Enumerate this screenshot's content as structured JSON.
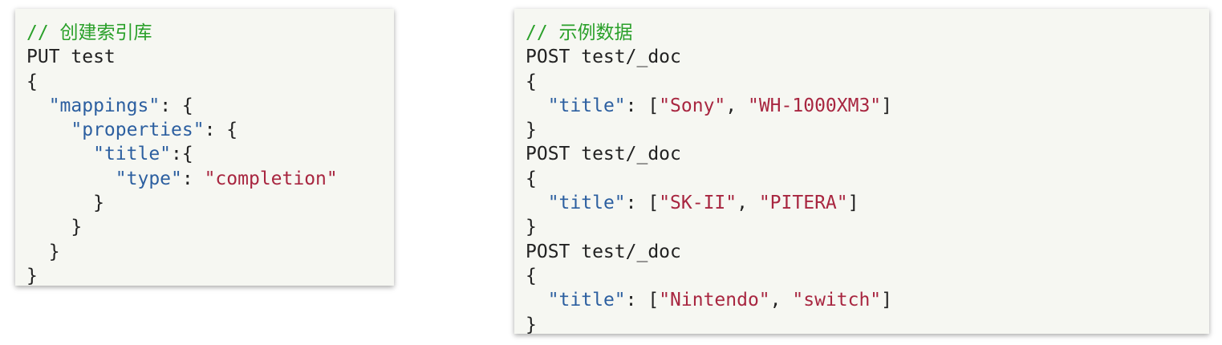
{
  "blocks": [
    {
      "lines": [
        [
          {
            "c": "comment",
            "t": "// 创建索引库"
          }
        ],
        [
          {
            "c": "plain",
            "t": "PUT test"
          }
        ],
        [
          {
            "c": "plain",
            "t": "{"
          }
        ],
        [
          {
            "c": "plain",
            "t": "  "
          },
          {
            "c": "key",
            "t": "\"mappings\""
          },
          {
            "c": "plain",
            "t": ": {"
          }
        ],
        [
          {
            "c": "plain",
            "t": "    "
          },
          {
            "c": "key",
            "t": "\"properties\""
          },
          {
            "c": "plain",
            "t": ": {"
          }
        ],
        [
          {
            "c": "plain",
            "t": "      "
          },
          {
            "c": "key",
            "t": "\"title\""
          },
          {
            "c": "plain",
            "t": ":{"
          }
        ],
        [
          {
            "c": "plain",
            "t": "        "
          },
          {
            "c": "key",
            "t": "\"type\""
          },
          {
            "c": "plain",
            "t": ": "
          },
          {
            "c": "str",
            "t": "\"completion\""
          }
        ],
        [
          {
            "c": "plain",
            "t": "      }"
          }
        ],
        [
          {
            "c": "plain",
            "t": "    }"
          }
        ],
        [
          {
            "c": "plain",
            "t": "  }"
          }
        ],
        [
          {
            "c": "plain",
            "t": "}"
          }
        ]
      ]
    },
    {
      "lines": [
        [
          {
            "c": "comment",
            "t": "// 示例数据"
          }
        ],
        [
          {
            "c": "plain",
            "t": "POST test/_doc"
          }
        ],
        [
          {
            "c": "plain",
            "t": "{"
          }
        ],
        [
          {
            "c": "plain",
            "t": "  "
          },
          {
            "c": "key",
            "t": "\"title\""
          },
          {
            "c": "plain",
            "t": ": ["
          },
          {
            "c": "str",
            "t": "\"Sony\""
          },
          {
            "c": "plain",
            "t": ", "
          },
          {
            "c": "str",
            "t": "\"WH-1000XM3\""
          },
          {
            "c": "plain",
            "t": "]"
          }
        ],
        [
          {
            "c": "plain",
            "t": "}"
          }
        ],
        [
          {
            "c": "plain",
            "t": "POST test/_doc"
          }
        ],
        [
          {
            "c": "plain",
            "t": "{"
          }
        ],
        [
          {
            "c": "plain",
            "t": "  "
          },
          {
            "c": "key",
            "t": "\"title\""
          },
          {
            "c": "plain",
            "t": ": ["
          },
          {
            "c": "str",
            "t": "\"SK-II\""
          },
          {
            "c": "plain",
            "t": ", "
          },
          {
            "c": "str",
            "t": "\"PITERA\""
          },
          {
            "c": "plain",
            "t": "]"
          }
        ],
        [
          {
            "c": "plain",
            "t": "}"
          }
        ],
        [
          {
            "c": "plain",
            "t": "POST test/_doc"
          }
        ],
        [
          {
            "c": "plain",
            "t": "{"
          }
        ],
        [
          {
            "c": "plain",
            "t": "  "
          },
          {
            "c": "key",
            "t": "\"title\""
          },
          {
            "c": "plain",
            "t": ": ["
          },
          {
            "c": "str",
            "t": "\"Nintendo\""
          },
          {
            "c": "plain",
            "t": ", "
          },
          {
            "c": "str",
            "t": "\"switch\""
          },
          {
            "c": "plain",
            "t": "]"
          }
        ],
        [
          {
            "c": "plain",
            "t": "}"
          }
        ]
      ]
    }
  ],
  "colors": {
    "comment": "#2aa02a",
    "key": "#2c5fa0",
    "string": "#a82640",
    "text": "#222222",
    "card_background": "#f6f7f2"
  }
}
